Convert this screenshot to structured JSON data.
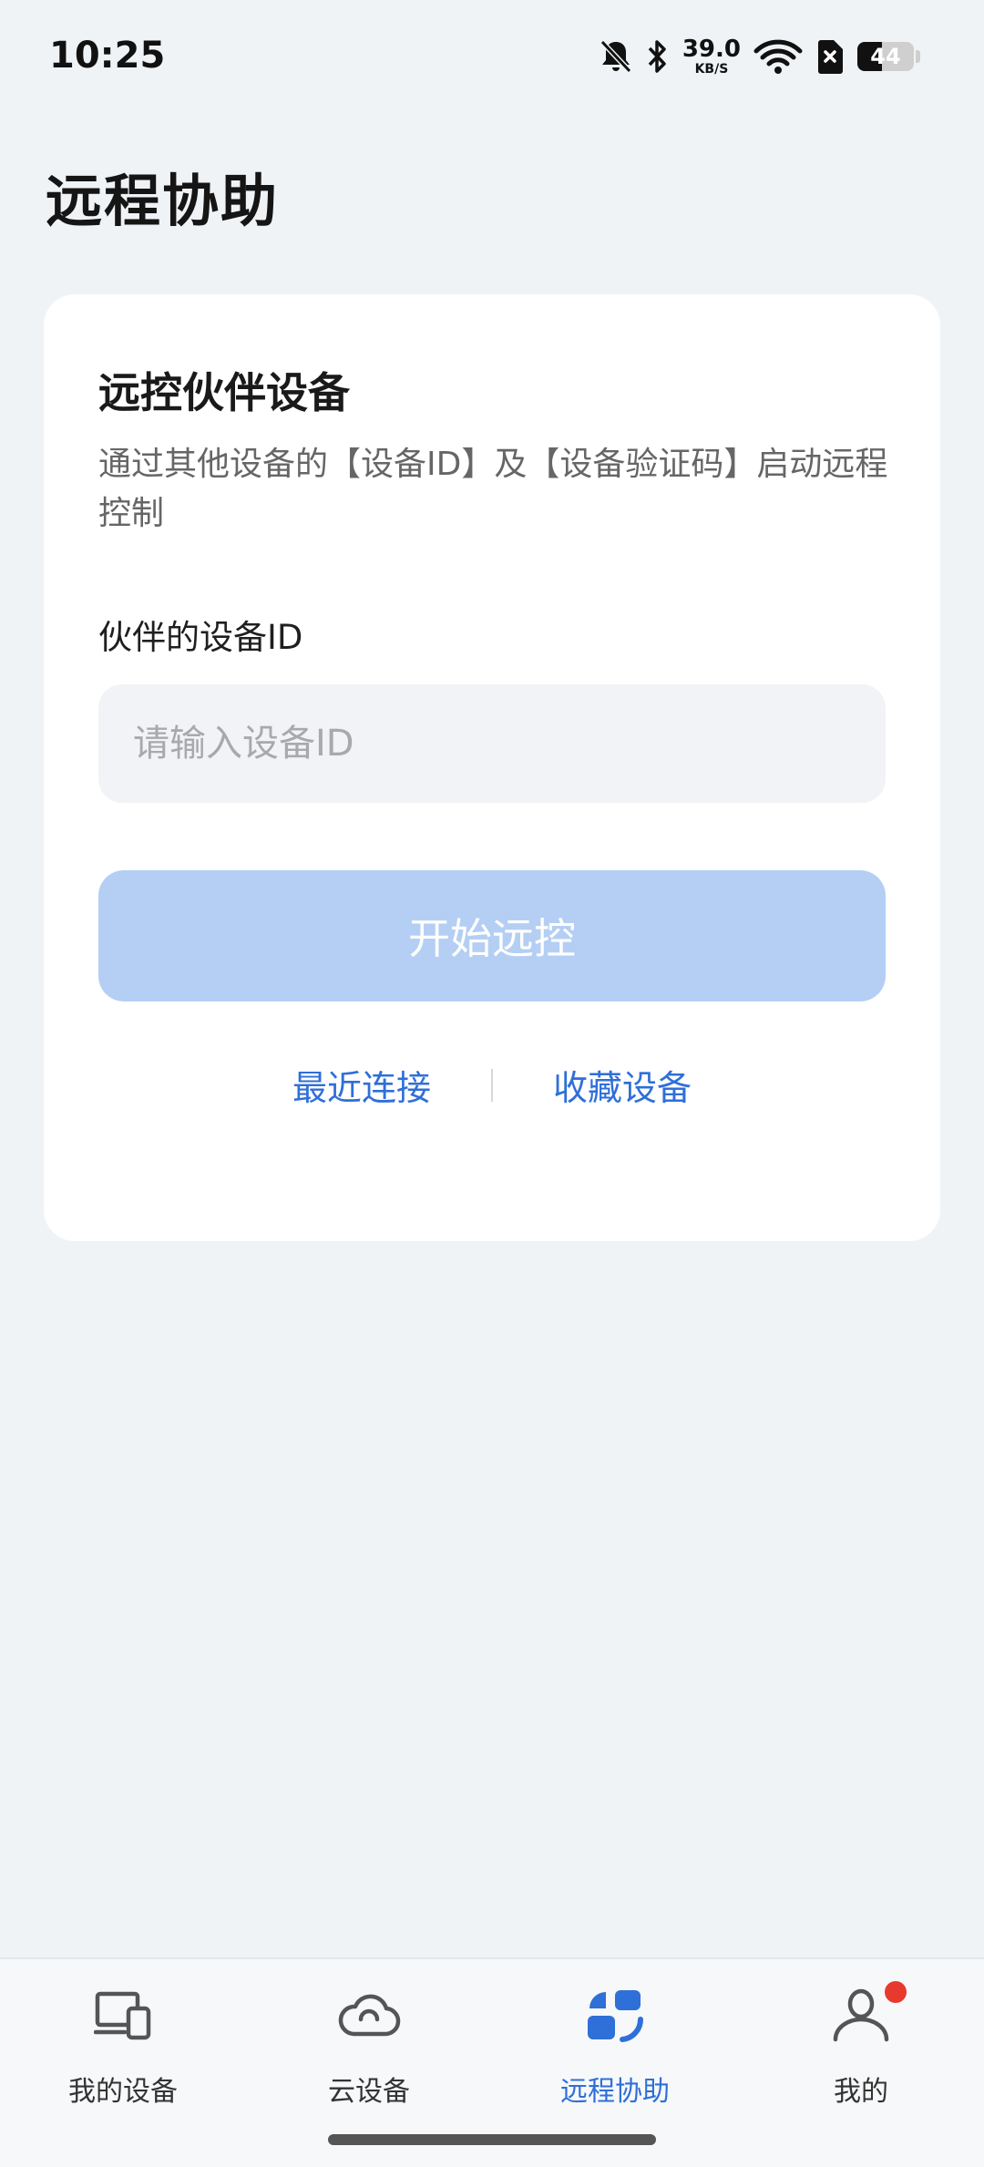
{
  "status_bar": {
    "time": "10:25",
    "net_speed_value": "39.0",
    "net_speed_unit": "KB/S",
    "battery_level": "44",
    "icons": [
      "bell-muted-icon",
      "bluetooth-icon",
      "wifi-icon",
      "sim-off-icon",
      "battery-icon"
    ]
  },
  "page": {
    "title": "远程协助"
  },
  "card": {
    "title": "远控伙伴设备",
    "description": "通过其他设备的【设备ID】及【设备验证码】启动远程控制",
    "field_label": "伙伴的设备ID",
    "input_value": "",
    "input_placeholder": "请输入设备ID",
    "start_button_label": "开始远控",
    "recent_link_label": "最近连接",
    "favorites_link_label": "收藏设备"
  },
  "bottom_nav": {
    "items": [
      {
        "label": "我的设备",
        "icon": "devices-icon",
        "active": false
      },
      {
        "label": "云设备",
        "icon": "cloud-icon",
        "active": false
      },
      {
        "label": "远程协助",
        "icon": "remote-assist-icon",
        "active": true
      },
      {
        "label": "我的",
        "icon": "profile-icon",
        "active": false,
        "badge": true
      }
    ]
  },
  "colors": {
    "accent": "#2f6fd8",
    "button_disabled": "#b4cff3",
    "background": "#eff3f6",
    "badge": "#e8392f"
  }
}
